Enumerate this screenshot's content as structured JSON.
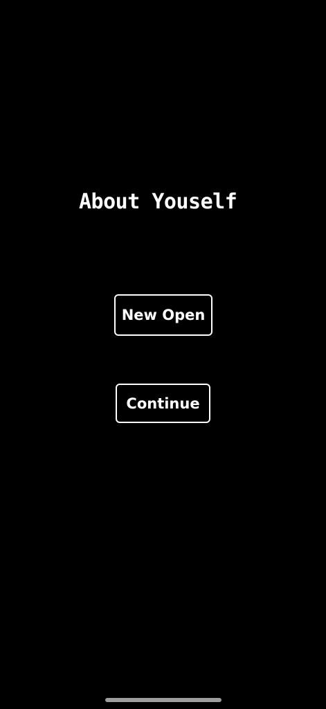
{
  "screen": {
    "title": "About Youself"
  },
  "buttons": {
    "new_open_label": "New Open",
    "continue_label": "Continue"
  },
  "colors": {
    "background": "#000000",
    "foreground": "#ffffff",
    "home_indicator": "#9e9e9e"
  }
}
